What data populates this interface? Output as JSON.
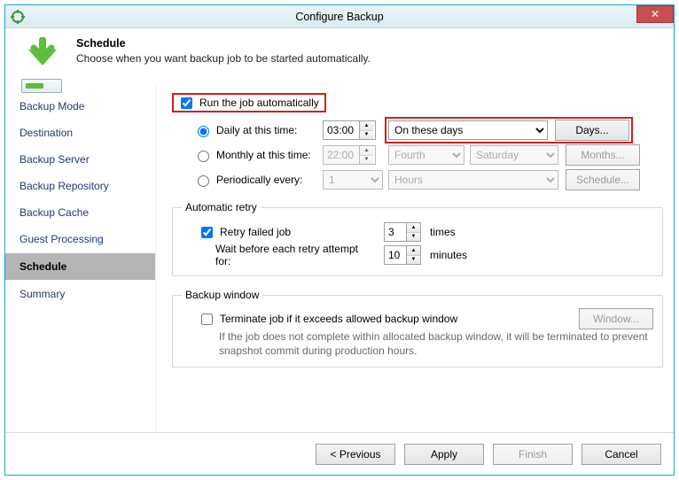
{
  "window": {
    "title": "Configure Backup",
    "close_glyph": "✕"
  },
  "header": {
    "title": "Schedule",
    "subtitle": "Choose when you want backup job to be started automatically."
  },
  "sidebar": {
    "items": [
      {
        "label": "Backup Mode"
      },
      {
        "label": "Destination"
      },
      {
        "label": "Backup Server"
      },
      {
        "label": "Backup Repository"
      },
      {
        "label": "Backup Cache"
      },
      {
        "label": "Guest Processing"
      },
      {
        "label": "Schedule"
      },
      {
        "label": "Summary"
      }
    ],
    "selected_index": 6
  },
  "schedule": {
    "auto_label": "Run the job automatically",
    "daily_label": "Daily at this time:",
    "daily_time": "03:00",
    "monthly_label": "Monthly at this time:",
    "monthly_time": "22:00",
    "periodic_label": "Periodically every:",
    "periodic_value": "1",
    "days_mode": "On these days",
    "monthly_week": "Fourth",
    "monthly_day": "Saturday",
    "periodic_unit": "Hours",
    "days_btn": "Days...",
    "months_btn": "Months...",
    "schedule_btn": "Schedule..."
  },
  "retry": {
    "legend": "Automatic retry",
    "enable_label": "Retry failed job",
    "times_value": "3",
    "times_suffix": "times",
    "wait_label": "Wait before each retry attempt for:",
    "wait_value": "10",
    "wait_suffix": "minutes"
  },
  "window_sec": {
    "legend": "Backup window",
    "enable_label": "Terminate job if it exceeds allowed backup window",
    "window_btn": "Window...",
    "hint": "If the job does not complete within allocated backup window, it will be terminated to prevent snapshot commit during production hours."
  },
  "footer": {
    "previous": "< Previous",
    "apply": "Apply",
    "finish": "Finish",
    "cancel": "Cancel"
  }
}
